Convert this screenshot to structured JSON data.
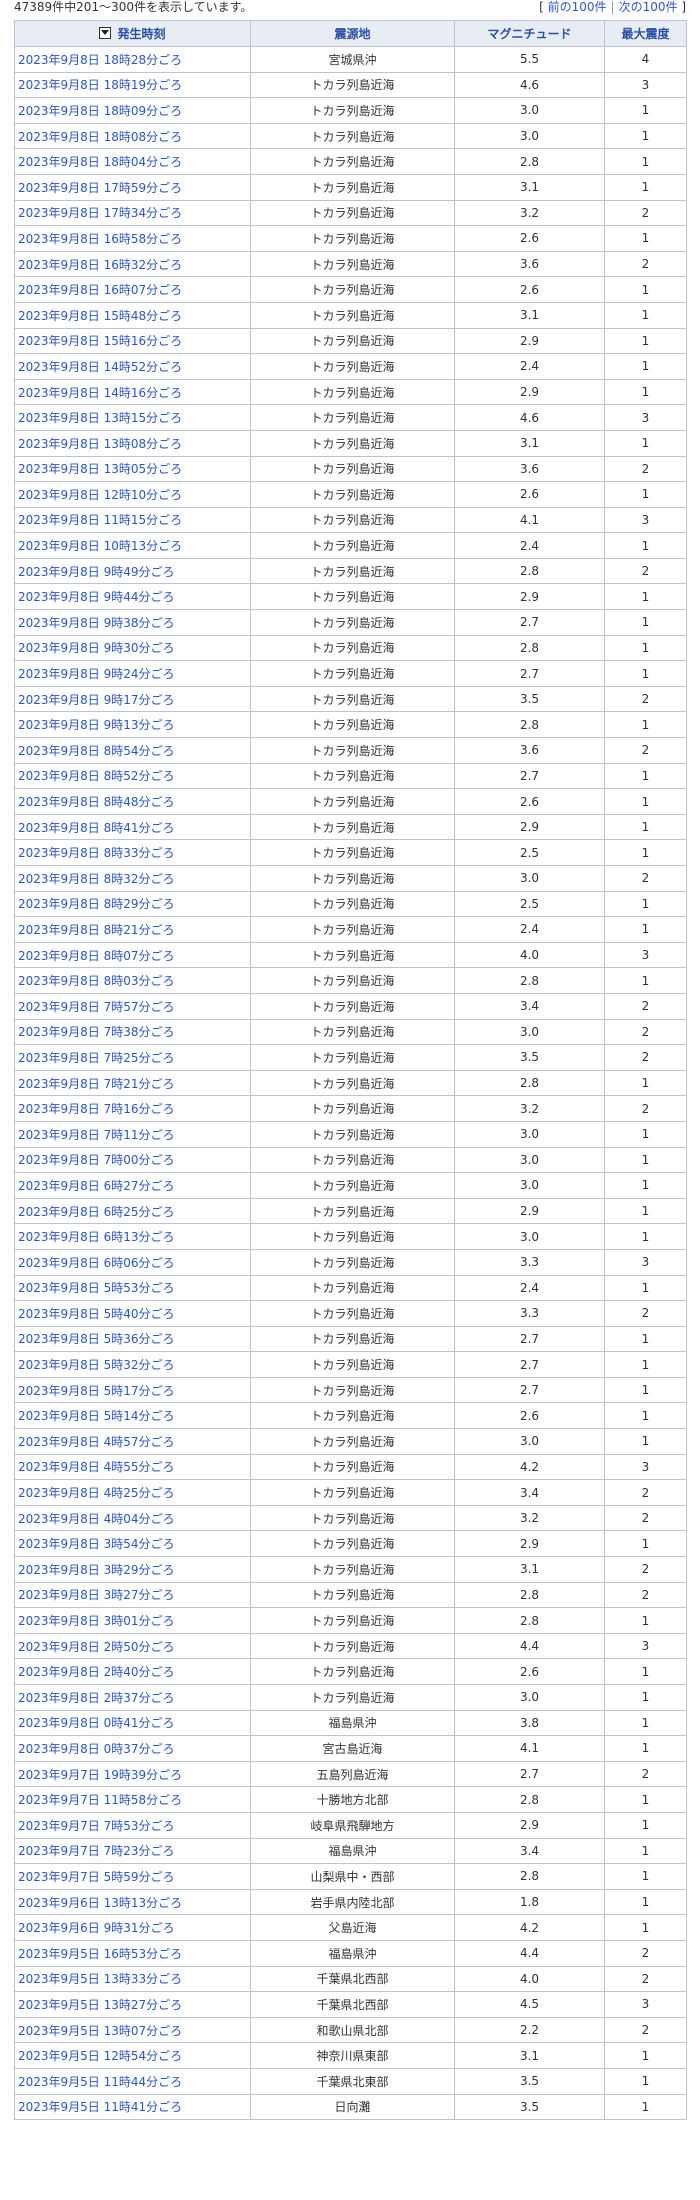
{
  "summary": "47389件中201～300件を表示しています。",
  "pager": {
    "open": "[",
    "prev": "前の100件",
    "sep": "|",
    "next": "次の100件",
    "close": "]"
  },
  "table": {
    "headers": {
      "time": "発生時刻",
      "place": "震源地",
      "magnitude": "マグニチュード",
      "intensity": "最大震度"
    },
    "rows": [
      {
        "time": "2023年9月8日 18時28分ごろ",
        "place": "宮城県沖",
        "mag": "5.5",
        "int": "4"
      },
      {
        "time": "2023年9月8日 18時19分ごろ",
        "place": "トカラ列島近海",
        "mag": "4.6",
        "int": "3"
      },
      {
        "time": "2023年9月8日 18時09分ごろ",
        "place": "トカラ列島近海",
        "mag": "3.0",
        "int": "1"
      },
      {
        "time": "2023年9月8日 18時08分ごろ",
        "place": "トカラ列島近海",
        "mag": "3.0",
        "int": "1"
      },
      {
        "time": "2023年9月8日 18時04分ごろ",
        "place": "トカラ列島近海",
        "mag": "2.8",
        "int": "1"
      },
      {
        "time": "2023年9月8日 17時59分ごろ",
        "place": "トカラ列島近海",
        "mag": "3.1",
        "int": "1"
      },
      {
        "time": "2023年9月8日 17時34分ごろ",
        "place": "トカラ列島近海",
        "mag": "3.2",
        "int": "2"
      },
      {
        "time": "2023年9月8日 16時58分ごろ",
        "place": "トカラ列島近海",
        "mag": "2.6",
        "int": "1"
      },
      {
        "time": "2023年9月8日 16時32分ごろ",
        "place": "トカラ列島近海",
        "mag": "3.6",
        "int": "2"
      },
      {
        "time": "2023年9月8日 16時07分ごろ",
        "place": "トカラ列島近海",
        "mag": "2.6",
        "int": "1"
      },
      {
        "time": "2023年9月8日 15時48分ごろ",
        "place": "トカラ列島近海",
        "mag": "3.1",
        "int": "1"
      },
      {
        "time": "2023年9月8日 15時16分ごろ",
        "place": "トカラ列島近海",
        "mag": "2.9",
        "int": "1"
      },
      {
        "time": "2023年9月8日 14時52分ごろ",
        "place": "トカラ列島近海",
        "mag": "2.4",
        "int": "1"
      },
      {
        "time": "2023年9月8日 14時16分ごろ",
        "place": "トカラ列島近海",
        "mag": "2.9",
        "int": "1"
      },
      {
        "time": "2023年9月8日 13時15分ごろ",
        "place": "トカラ列島近海",
        "mag": "4.6",
        "int": "3"
      },
      {
        "time": "2023年9月8日 13時08分ごろ",
        "place": "トカラ列島近海",
        "mag": "3.1",
        "int": "1"
      },
      {
        "time": "2023年9月8日 13時05分ごろ",
        "place": "トカラ列島近海",
        "mag": "3.6",
        "int": "2"
      },
      {
        "time": "2023年9月8日 12時10分ごろ",
        "place": "トカラ列島近海",
        "mag": "2.6",
        "int": "1"
      },
      {
        "time": "2023年9月8日 11時15分ごろ",
        "place": "トカラ列島近海",
        "mag": "4.1",
        "int": "3"
      },
      {
        "time": "2023年9月8日 10時13分ごろ",
        "place": "トカラ列島近海",
        "mag": "2.4",
        "int": "1"
      },
      {
        "time": "2023年9月8日 9時49分ごろ",
        "place": "トカラ列島近海",
        "mag": "2.8",
        "int": "2"
      },
      {
        "time": "2023年9月8日 9時44分ごろ",
        "place": "トカラ列島近海",
        "mag": "2.9",
        "int": "1"
      },
      {
        "time": "2023年9月8日 9時38分ごろ",
        "place": "トカラ列島近海",
        "mag": "2.7",
        "int": "1"
      },
      {
        "time": "2023年9月8日 9時30分ごろ",
        "place": "トカラ列島近海",
        "mag": "2.8",
        "int": "1"
      },
      {
        "time": "2023年9月8日 9時24分ごろ",
        "place": "トカラ列島近海",
        "mag": "2.7",
        "int": "1"
      },
      {
        "time": "2023年9月8日 9時17分ごろ",
        "place": "トカラ列島近海",
        "mag": "3.5",
        "int": "2"
      },
      {
        "time": "2023年9月8日 9時13分ごろ",
        "place": "トカラ列島近海",
        "mag": "2.8",
        "int": "1"
      },
      {
        "time": "2023年9月8日 8時54分ごろ",
        "place": "トカラ列島近海",
        "mag": "3.6",
        "int": "2"
      },
      {
        "time": "2023年9月8日 8時52分ごろ",
        "place": "トカラ列島近海",
        "mag": "2.7",
        "int": "1"
      },
      {
        "time": "2023年9月8日 8時48分ごろ",
        "place": "トカラ列島近海",
        "mag": "2.6",
        "int": "1"
      },
      {
        "time": "2023年9月8日 8時41分ごろ",
        "place": "トカラ列島近海",
        "mag": "2.9",
        "int": "1"
      },
      {
        "time": "2023年9月8日 8時33分ごろ",
        "place": "トカラ列島近海",
        "mag": "2.5",
        "int": "1"
      },
      {
        "time": "2023年9月8日 8時32分ごろ",
        "place": "トカラ列島近海",
        "mag": "3.0",
        "int": "2"
      },
      {
        "time": "2023年9月8日 8時29分ごろ",
        "place": "トカラ列島近海",
        "mag": "2.5",
        "int": "1"
      },
      {
        "time": "2023年9月8日 8時21分ごろ",
        "place": "トカラ列島近海",
        "mag": "2.4",
        "int": "1"
      },
      {
        "time": "2023年9月8日 8時07分ごろ",
        "place": "トカラ列島近海",
        "mag": "4.0",
        "int": "3"
      },
      {
        "time": "2023年9月8日 8時03分ごろ",
        "place": "トカラ列島近海",
        "mag": "2.8",
        "int": "1"
      },
      {
        "time": "2023年9月8日 7時57分ごろ",
        "place": "トカラ列島近海",
        "mag": "3.4",
        "int": "2"
      },
      {
        "time": "2023年9月8日 7時38分ごろ",
        "place": "トカラ列島近海",
        "mag": "3.0",
        "int": "2"
      },
      {
        "time": "2023年9月8日 7時25分ごろ",
        "place": "トカラ列島近海",
        "mag": "3.5",
        "int": "2"
      },
      {
        "time": "2023年9月8日 7時21分ごろ",
        "place": "トカラ列島近海",
        "mag": "2.8",
        "int": "1"
      },
      {
        "time": "2023年9月8日 7時16分ごろ",
        "place": "トカラ列島近海",
        "mag": "3.2",
        "int": "2"
      },
      {
        "time": "2023年9月8日 7時11分ごろ",
        "place": "トカラ列島近海",
        "mag": "3.0",
        "int": "1"
      },
      {
        "time": "2023年9月8日 7時00分ごろ",
        "place": "トカラ列島近海",
        "mag": "3.0",
        "int": "1"
      },
      {
        "time": "2023年9月8日 6時27分ごろ",
        "place": "トカラ列島近海",
        "mag": "3.0",
        "int": "1"
      },
      {
        "time": "2023年9月8日 6時25分ごろ",
        "place": "トカラ列島近海",
        "mag": "2.9",
        "int": "1"
      },
      {
        "time": "2023年9月8日 6時13分ごろ",
        "place": "トカラ列島近海",
        "mag": "3.0",
        "int": "1"
      },
      {
        "time": "2023年9月8日 6時06分ごろ",
        "place": "トカラ列島近海",
        "mag": "3.3",
        "int": "3"
      },
      {
        "time": "2023年9月8日 5時53分ごろ",
        "place": "トカラ列島近海",
        "mag": "2.4",
        "int": "1"
      },
      {
        "time": "2023年9月8日 5時40分ごろ",
        "place": "トカラ列島近海",
        "mag": "3.3",
        "int": "2"
      },
      {
        "time": "2023年9月8日 5時36分ごろ",
        "place": "トカラ列島近海",
        "mag": "2.7",
        "int": "1"
      },
      {
        "time": "2023年9月8日 5時32分ごろ",
        "place": "トカラ列島近海",
        "mag": "2.7",
        "int": "1"
      },
      {
        "time": "2023年9月8日 5時17分ごろ",
        "place": "トカラ列島近海",
        "mag": "2.7",
        "int": "1"
      },
      {
        "time": "2023年9月8日 5時14分ごろ",
        "place": "トカラ列島近海",
        "mag": "2.6",
        "int": "1"
      },
      {
        "time": "2023年9月8日 4時57分ごろ",
        "place": "トカラ列島近海",
        "mag": "3.0",
        "int": "1"
      },
      {
        "time": "2023年9月8日 4時55分ごろ",
        "place": "トカラ列島近海",
        "mag": "4.2",
        "int": "3"
      },
      {
        "time": "2023年9月8日 4時25分ごろ",
        "place": "トカラ列島近海",
        "mag": "3.4",
        "int": "2"
      },
      {
        "time": "2023年9月8日 4時04分ごろ",
        "place": "トカラ列島近海",
        "mag": "3.2",
        "int": "2"
      },
      {
        "time": "2023年9月8日 3時54分ごろ",
        "place": "トカラ列島近海",
        "mag": "2.9",
        "int": "1"
      },
      {
        "time": "2023年9月8日 3時29分ごろ",
        "place": "トカラ列島近海",
        "mag": "3.1",
        "int": "2"
      },
      {
        "time": "2023年9月8日 3時27分ごろ",
        "place": "トカラ列島近海",
        "mag": "2.8",
        "int": "2"
      },
      {
        "time": "2023年9月8日 3時01分ごろ",
        "place": "トカラ列島近海",
        "mag": "2.8",
        "int": "1"
      },
      {
        "time": "2023年9月8日 2時50分ごろ",
        "place": "トカラ列島近海",
        "mag": "4.4",
        "int": "3"
      },
      {
        "time": "2023年9月8日 2時40分ごろ",
        "place": "トカラ列島近海",
        "mag": "2.6",
        "int": "1"
      },
      {
        "time": "2023年9月8日 2時37分ごろ",
        "place": "トカラ列島近海",
        "mag": "3.0",
        "int": "1"
      },
      {
        "time": "2023年9月8日 0時41分ごろ",
        "place": "福島県沖",
        "mag": "3.8",
        "int": "1"
      },
      {
        "time": "2023年9月8日 0時37分ごろ",
        "place": "宮古島近海",
        "mag": "4.1",
        "int": "1"
      },
      {
        "time": "2023年9月7日 19時39分ごろ",
        "place": "五島列島近海",
        "mag": "2.7",
        "int": "2"
      },
      {
        "time": "2023年9月7日 11時58分ごろ",
        "place": "十勝地方北部",
        "mag": "2.8",
        "int": "1"
      },
      {
        "time": "2023年9月7日 7時53分ごろ",
        "place": "岐阜県飛騨地方",
        "mag": "2.9",
        "int": "1"
      },
      {
        "time": "2023年9月7日 7時23分ごろ",
        "place": "福島県沖",
        "mag": "3.4",
        "int": "1"
      },
      {
        "time": "2023年9月7日 5時59分ごろ",
        "place": "山梨県中・西部",
        "mag": "2.8",
        "int": "1"
      },
      {
        "time": "2023年9月6日 13時13分ごろ",
        "place": "岩手県内陸北部",
        "mag": "1.8",
        "int": "1"
      },
      {
        "time": "2023年9月6日 9時31分ごろ",
        "place": "父島近海",
        "mag": "4.2",
        "int": "1"
      },
      {
        "time": "2023年9月5日 16時53分ごろ",
        "place": "福島県沖",
        "mag": "4.4",
        "int": "2"
      },
      {
        "time": "2023年9月5日 13時33分ごろ",
        "place": "千葉県北西部",
        "mag": "4.0",
        "int": "2"
      },
      {
        "time": "2023年9月5日 13時27分ごろ",
        "place": "千葉県北西部",
        "mag": "4.5",
        "int": "3"
      },
      {
        "time": "2023年9月5日 13時07分ごろ",
        "place": "和歌山県北部",
        "mag": "2.2",
        "int": "2"
      },
      {
        "time": "2023年9月5日 12時54分ごろ",
        "place": "神奈川県東部",
        "mag": "3.1",
        "int": "1"
      },
      {
        "time": "2023年9月5日 11時44分ごろ",
        "place": "千葉県北東部",
        "mag": "3.5",
        "int": "1"
      },
      {
        "time": "2023年9月5日 11時41分ごろ",
        "place": "日向灘",
        "mag": "3.5",
        "int": "1"
      }
    ]
  }
}
